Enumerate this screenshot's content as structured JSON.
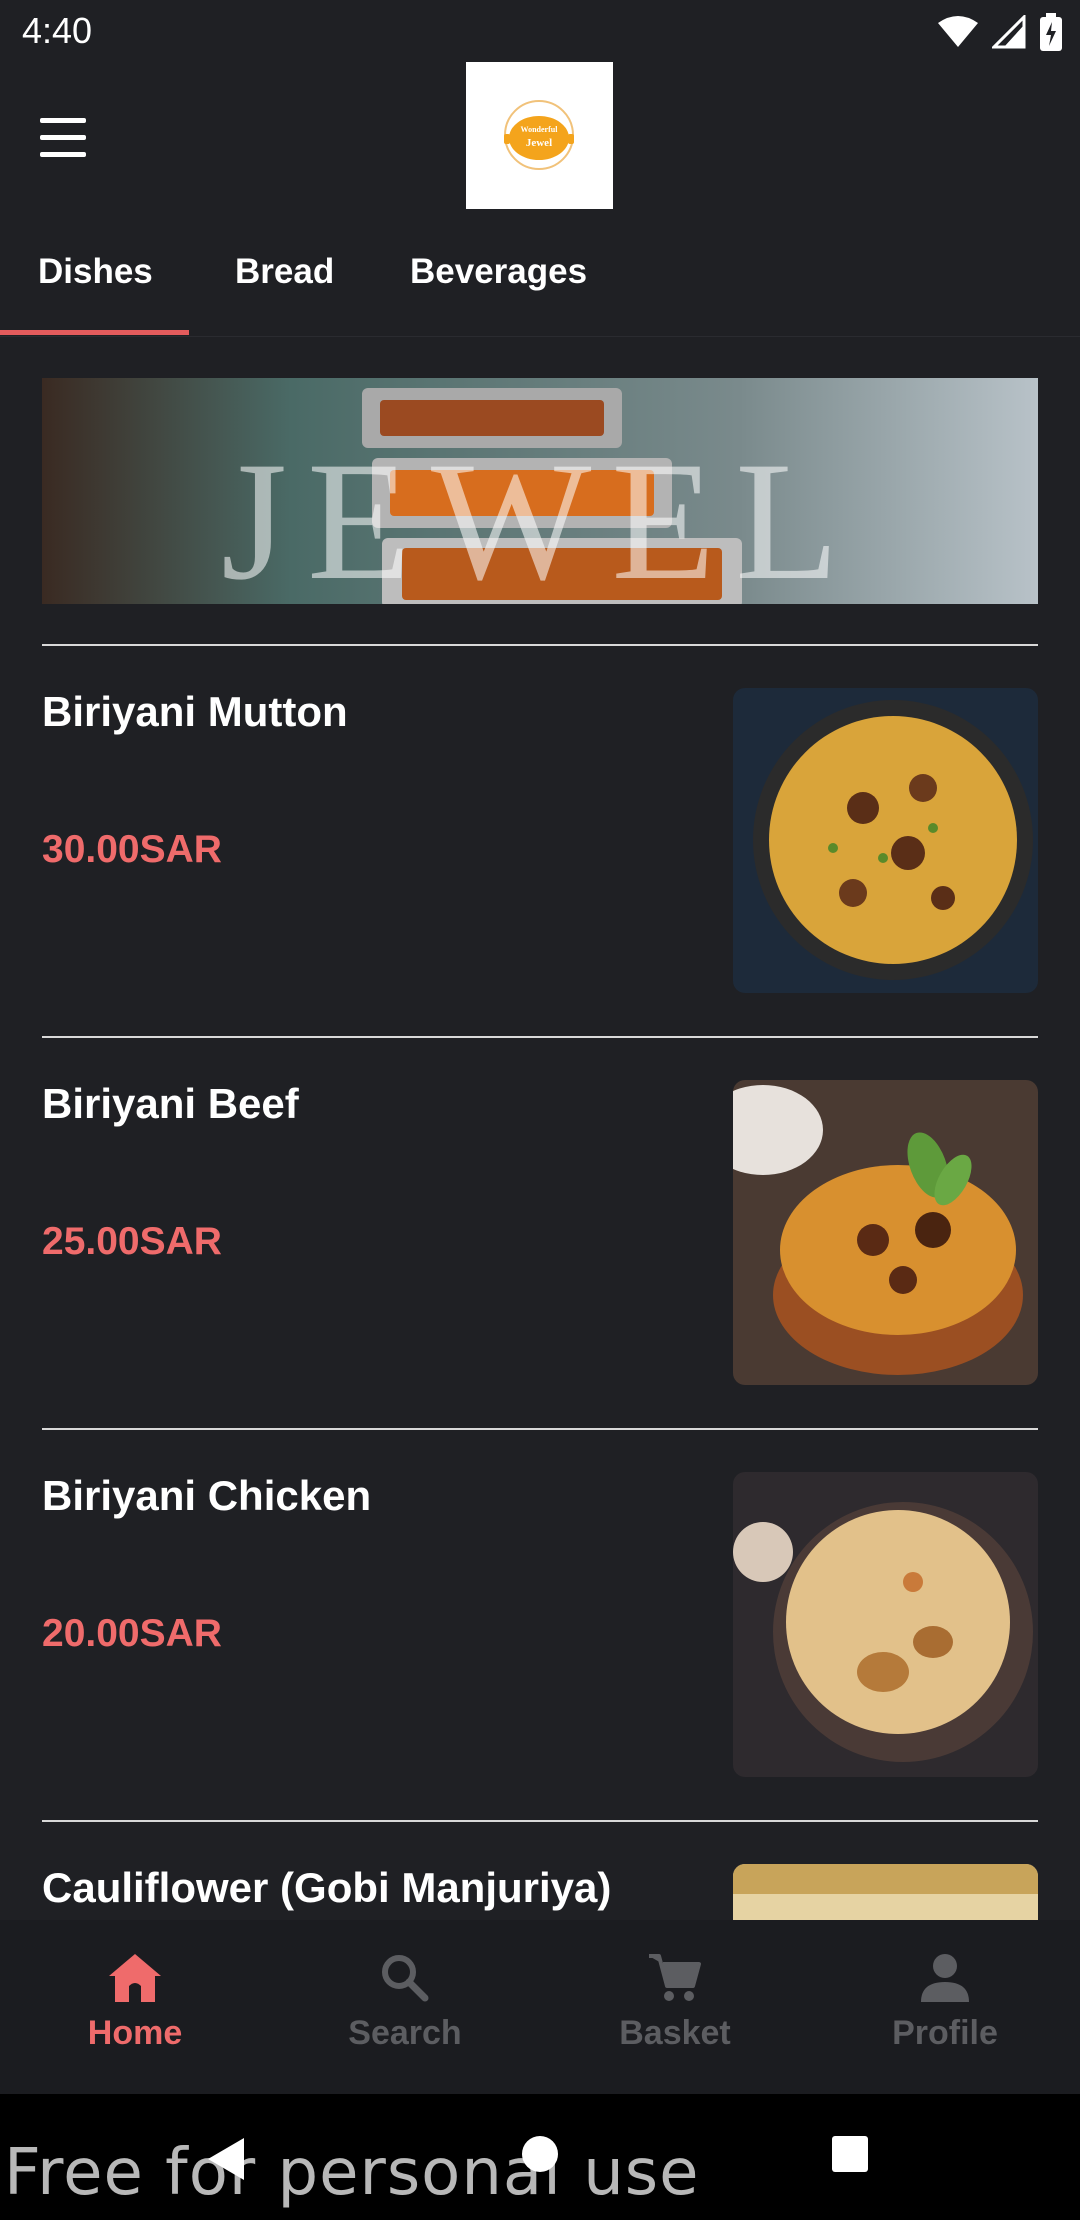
{
  "status_bar": {
    "time": "4:40"
  },
  "app": {
    "logo_text_top": "Wonderful",
    "logo_text_bottom": "Jewel"
  },
  "tabs": [
    {
      "label": "Dishes"
    },
    {
      "label": "Bread"
    },
    {
      "label": "Beverages"
    }
  ],
  "banner": {
    "text": "JEWEL"
  },
  "dishes": [
    {
      "name": "Biriyani Mutton",
      "price": "30.00SAR"
    },
    {
      "name": "Biriyani Beef",
      "price": "25.00SAR"
    },
    {
      "name": "Biriyani Chicken",
      "price": "20.00SAR"
    },
    {
      "name": "Cauliflower (Gobi Manjuriya)",
      "price": ""
    }
  ],
  "bottom_nav": [
    {
      "label": "Home",
      "icon": "home-icon"
    },
    {
      "label": "Search",
      "icon": "search-icon"
    },
    {
      "label": "Basket",
      "icon": "cart-icon"
    },
    {
      "label": "Profile",
      "icon": "person-icon"
    }
  ],
  "watermark": "Free for personal use",
  "colors": {
    "accent": "#ef6b6b",
    "background": "#1f2024",
    "nav_inactive": "#5c5d61"
  }
}
